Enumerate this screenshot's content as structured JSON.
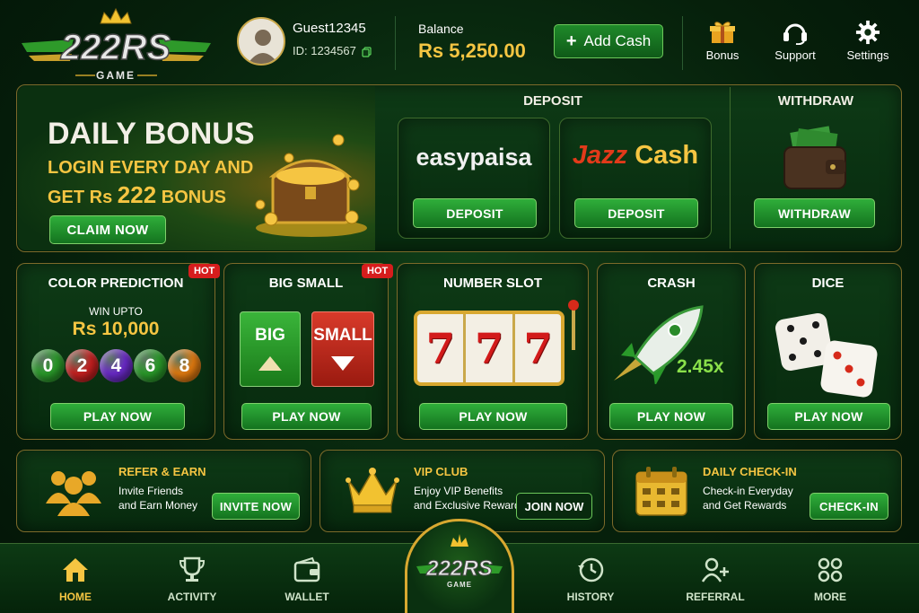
{
  "header": {
    "logo_text": "222RS",
    "logo_sub": "GAME",
    "username": "Guest12345",
    "user_id": "ID: 1234567",
    "balance_label": "Balance",
    "balance_value": "Rs 5,250.00",
    "add_cash_label": "Add Cash",
    "icons": [
      {
        "label": "Bonus",
        "icon": "gift-icon"
      },
      {
        "label": "Support",
        "icon": "headset-icon"
      },
      {
        "label": "Settings",
        "icon": "gear-icon"
      }
    ]
  },
  "banner": {
    "title": "DAILY BONUS",
    "line1": "LOGIN EVERY DAY AND",
    "line2_prefix": "GET Rs ",
    "line2_amount": "222",
    "line2_suffix": " BONUS",
    "cta": "CLAIM NOW"
  },
  "deposit": {
    "title": "DEPOSIT",
    "easypaisa": "easypaisa",
    "jazz": "Jazz",
    "cash": "Cash",
    "button": "DEPOSIT"
  },
  "withdraw": {
    "title": "WITHDRAW",
    "button": "WITHDRAW"
  },
  "games": {
    "color": {
      "title": "COLOR PREDICTION",
      "hot": "HOT",
      "win_label": "WIN UPTO",
      "win_value": "Rs 10,000",
      "balls": [
        "0",
        "2",
        "4",
        "6",
        "8"
      ],
      "ball_colors": [
        "#2a9a2a",
        "#c62020",
        "#6a2ac8",
        "#2a9a2a",
        "#e07a10"
      ],
      "cta": "PLAY NOW"
    },
    "bigsmall": {
      "title": "BIG SMALL",
      "hot": "HOT",
      "big": "BIG",
      "small": "SMALL",
      "cta": "PLAY NOW"
    },
    "slot": {
      "title": "NUMBER SLOT",
      "reels": [
        "7",
        "7",
        "7"
      ],
      "cta": "PLAY NOW"
    },
    "crash": {
      "title": "CRASH",
      "multiplier": "2.45x",
      "cta": "PLAY NOW"
    },
    "dice": {
      "title": "DICE",
      "cta": "PLAY NOW"
    }
  },
  "promos": {
    "refer": {
      "title": "REFER & EARN",
      "line1": "Invite Friends",
      "line2": "and Earn Money",
      "cta": "INVITE NOW"
    },
    "vip": {
      "title": "VIP CLUB",
      "line1": "Enjoy VIP Benefits",
      "line2": "and Exclusive Rewards",
      "cta": "JOIN NOW"
    },
    "checkin": {
      "title": "DAILY CHECK-IN",
      "line1": "Check-in Everyday",
      "line2": "and Get Rewards",
      "cta": "CHECK-IN"
    }
  },
  "nav": {
    "home": "HOME",
    "activity": "ACTIVITY",
    "wallet": "WALLET",
    "center_logo": "222RS",
    "center_sub": "GAME",
    "history": "HISTORY",
    "referral": "REFERRAL",
    "more": "MORE"
  },
  "colors": {
    "accent_gold": "#f5c542",
    "green_button": "#14731f",
    "hot_red": "#d61d1d"
  }
}
